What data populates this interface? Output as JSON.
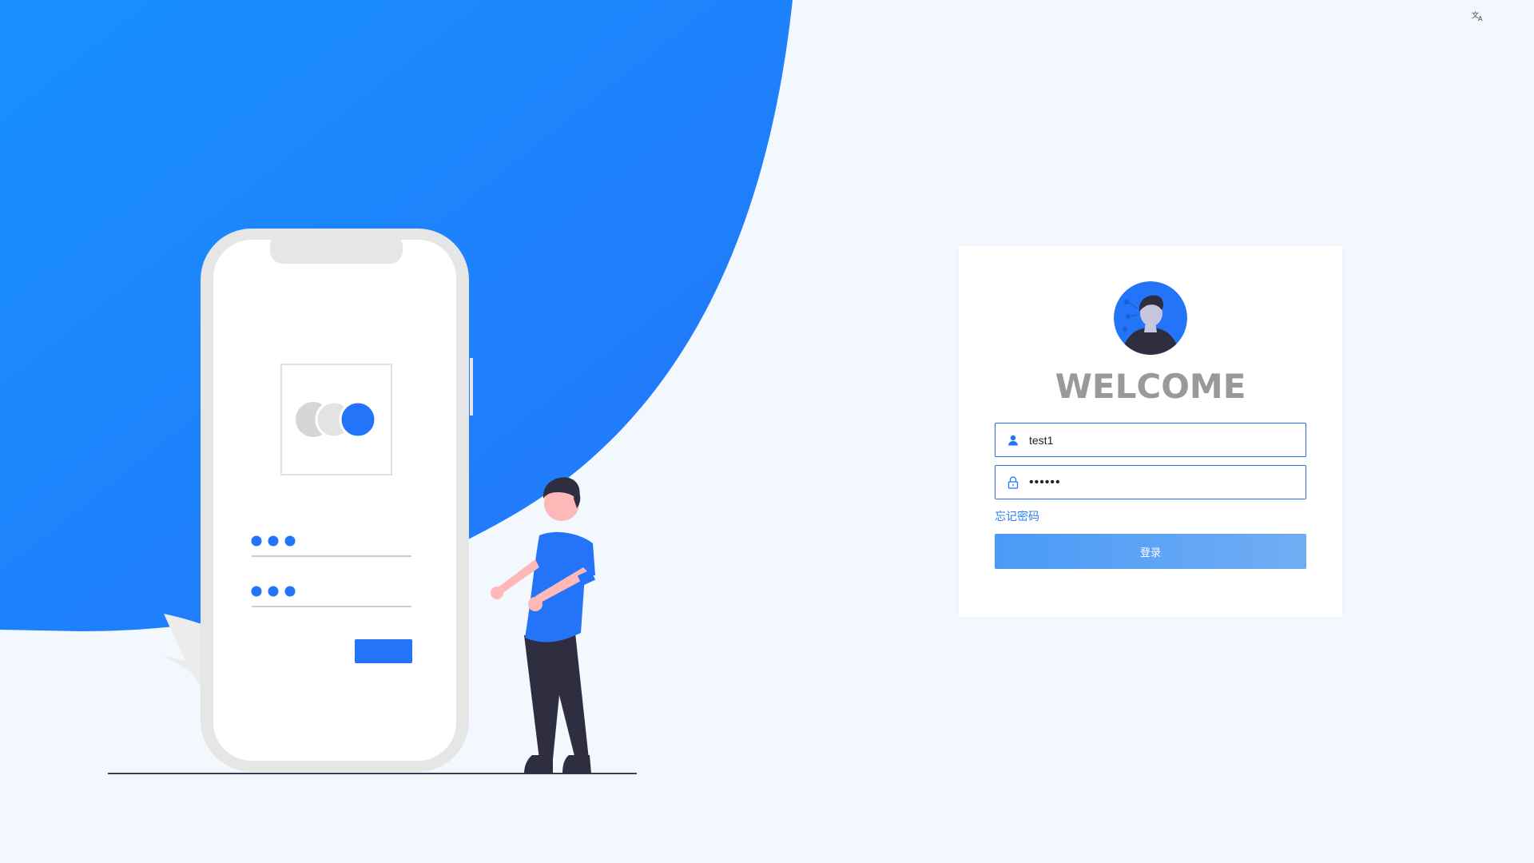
{
  "header": {
    "language_icon": "translate-icon"
  },
  "illustration": {
    "icon": "phone-login-illustration"
  },
  "login": {
    "avatar_icon": "user-avatar-icon",
    "title": "WELCOME",
    "username": {
      "icon": "user-icon",
      "value": "test1",
      "placeholder": ""
    },
    "password": {
      "icon": "lock-icon",
      "value": "••••••",
      "placeholder": ""
    },
    "forgot_password": "忘记密码",
    "submit_label": "登录"
  },
  "colors": {
    "accent": "#1f6feb",
    "background": "#f3f7fe",
    "button_start": "#4a9af7",
    "button_end": "#71adf3",
    "title": "#999999"
  }
}
